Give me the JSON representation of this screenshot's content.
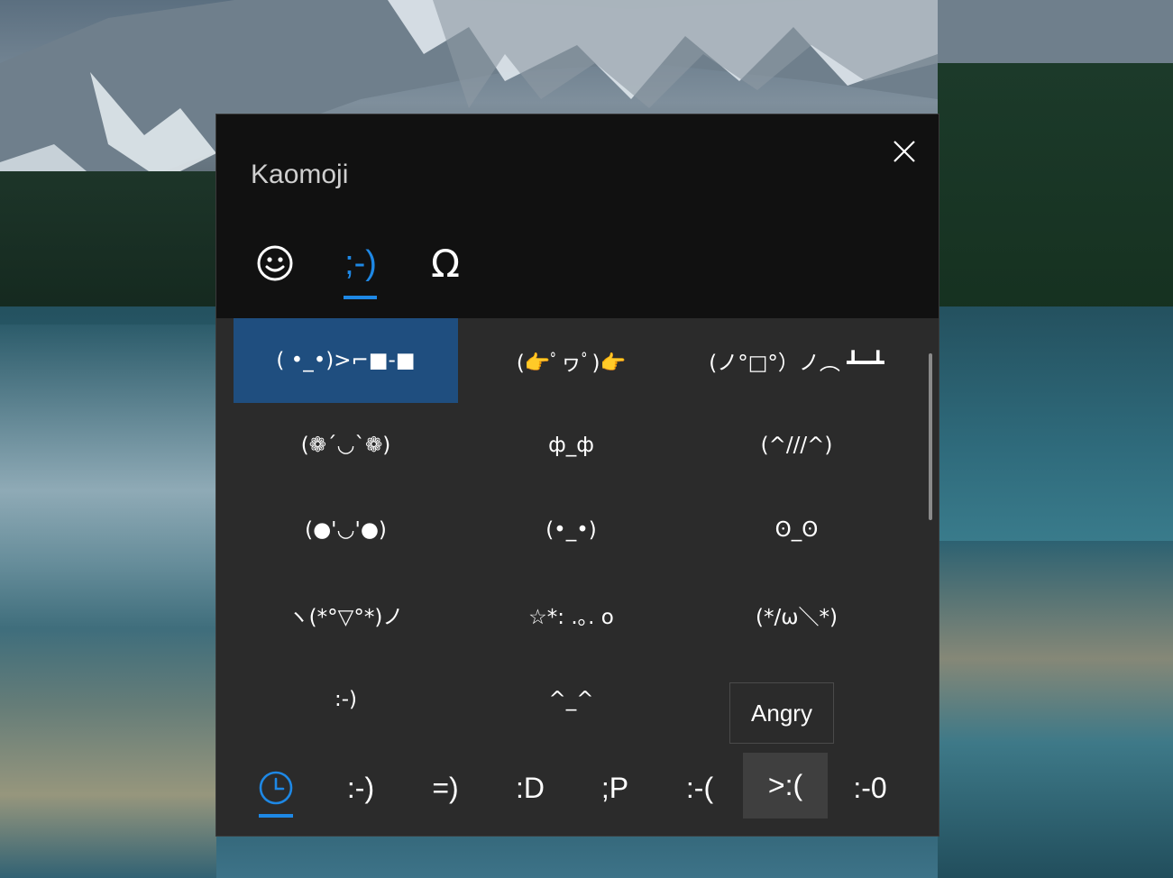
{
  "panel": {
    "title": "Kaomoji",
    "close_icon": "close-icon"
  },
  "tabs": [
    {
      "id": "emoji",
      "icon": "smiley-face-icon",
      "selected": false
    },
    {
      "id": "kaomoji",
      "label": ";-)",
      "selected": true
    },
    {
      "id": "symbols",
      "label": "Ω",
      "selected": false
    }
  ],
  "kaomoji_grid": [
    "( •_•)>⌐■-■",
    "(👉ﾟヮﾟ)👉",
    "(ノ°□°）ノ︵ ┻━┻",
    "(❁´◡`❁)",
    "ф_ф",
    "(^///^)",
    "(●'◡'●)",
    "(•_•)",
    "ʘ_ʘ",
    "ヽ(*°▽°*)ノ",
    "☆*: .｡. o",
    "(*/ω＼*)",
    ":-)",
    "^_^",
    ""
  ],
  "tooltip": {
    "text": "Angry"
  },
  "categories": [
    {
      "id": "recent",
      "icon": "clock-icon",
      "selected": true
    },
    {
      "id": "happy",
      "label": ":-)"
    },
    {
      "id": "smile",
      "label": "=)"
    },
    {
      "id": "laugh",
      "label": ":D"
    },
    {
      "id": "tongue",
      "label": ";P"
    },
    {
      "id": "sad",
      "label": ":-("
    },
    {
      "id": "angry",
      "label": ">:(",
      "hover": true
    },
    {
      "id": "surprised",
      "label": ":-0"
    }
  ],
  "colors": {
    "accent": "#1e88e5",
    "selected_cell": "#1f4e7f",
    "panel_bg": "#2b2b2b",
    "header_bg": "#111111"
  }
}
